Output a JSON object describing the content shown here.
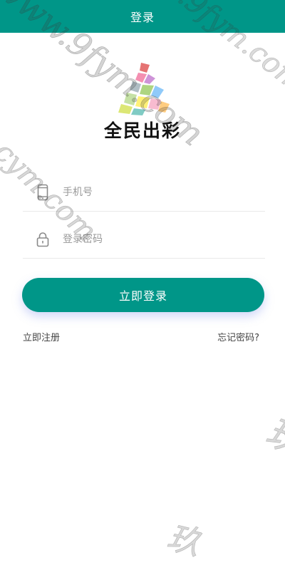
{
  "header": {
    "title": "登录"
  },
  "logo": {
    "text": "全民出彩"
  },
  "form": {
    "phone": {
      "placeholder": "手机号",
      "icon": "phone-icon"
    },
    "password": {
      "placeholder": "登录密码",
      "icon": "lock-icon"
    }
  },
  "actions": {
    "login_label": "立即登录",
    "register_label": "立即注册",
    "forgot_label": "忘记密码?"
  },
  "watermark": {
    "lines": [
      "www.9fym.com",
      "www.9fym.com",
      "cym.com",
      "玖",
      "玖"
    ]
  },
  "colors": {
    "primary": "#009688",
    "text_dark": "#444444",
    "placeholder": "#999999",
    "divider": "#e9e9e9"
  }
}
